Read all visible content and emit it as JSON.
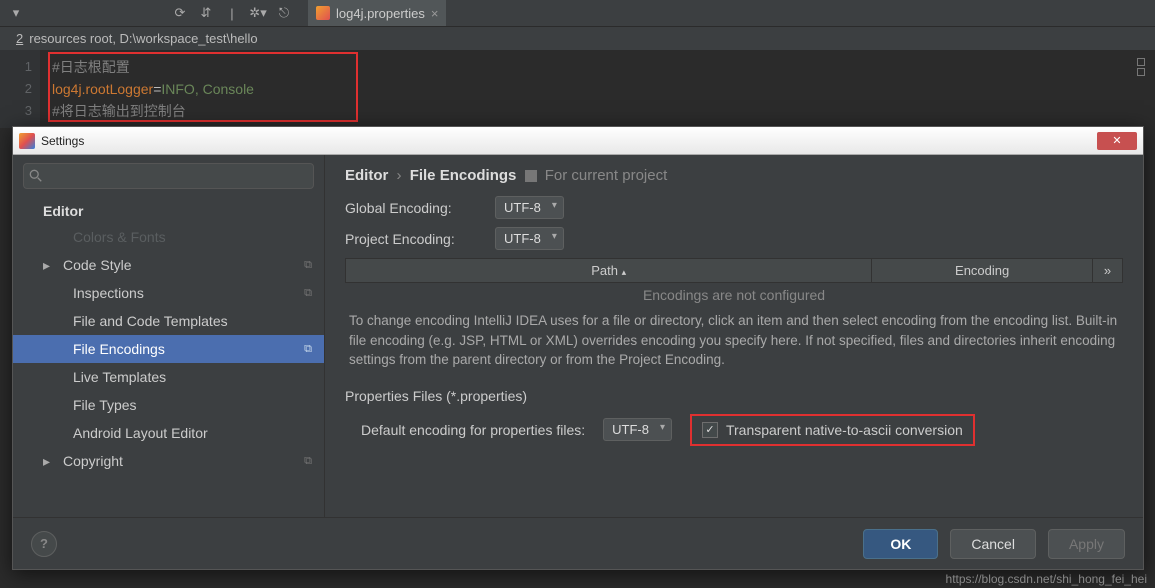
{
  "ide": {
    "tab_label": "log4j.properties",
    "breadcrumb": "resources root,  D:\\workspace_test\\hello",
    "breadcrumb_underline_char": "2"
  },
  "code": {
    "lines": [
      "1",
      "2",
      "3"
    ],
    "l1_comment": "#日志根配置",
    "l2_key": "log4j.rootLogger",
    "l2_eq": "=",
    "l2_val": "INFO, Console",
    "l3_comment": "#将日志输出到控制台"
  },
  "dialog": {
    "title": "Settings",
    "search_placeholder": "",
    "sidebar": {
      "header": "Editor",
      "faded": "Colors & Fonts",
      "items": [
        "Code Style",
        "Inspections",
        "File and Code Templates",
        "File Encodings",
        "Live Templates",
        "File Types",
        "Android Layout Editor",
        "Copyright"
      ]
    },
    "breadcrumb": {
      "p1": "Editor",
      "p2": "File Encodings",
      "sub": "For current project"
    },
    "global_label": "Global Encoding:",
    "global_val": "UTF-8",
    "project_label": "Project Encoding:",
    "project_val": "UTF-8",
    "th_path": "Path",
    "th_enc": "Encoding",
    "th_more": "»",
    "not_configured": "Encodings are not configured",
    "help": "To change encoding IntelliJ IDEA uses for a file or directory, click an item and then select encoding from the encoding list. Built-in file encoding (e.g. JSP, HTML or XML) overrides encoding you specify here. If not specified, files and directories inherit encoding settings from the parent directory or from the Project Encoding.",
    "props_section": "Properties Files (*.properties)",
    "props_label": "Default encoding for properties files:",
    "props_val": "UTF-8",
    "checkbox_label": "Transparent native-to-ascii conversion",
    "buttons": {
      "ok": "OK",
      "cancel": "Cancel",
      "apply": "Apply",
      "help": "?"
    }
  },
  "watermark": "https://blog.csdn.net/shi_hong_fei_hei"
}
